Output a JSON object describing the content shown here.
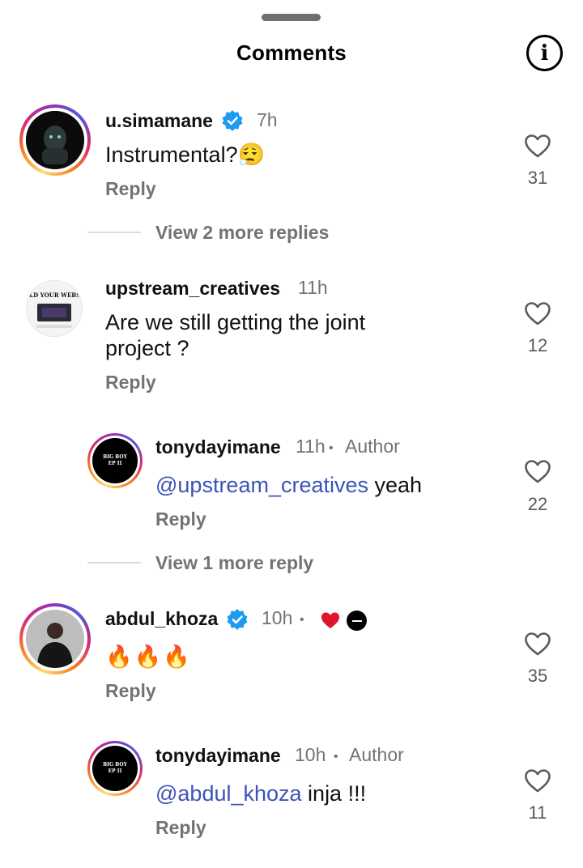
{
  "header": {
    "title": "Comments"
  },
  "colors": {
    "mention": "#3c53b8",
    "verified": "#1d9bf0",
    "heart_red": "#e0142a",
    "secondary_text": "#737373"
  },
  "comments": [
    {
      "username": "u.simamane",
      "verified": true,
      "time": "7h",
      "text": "Instrumental?😮‍💨",
      "reply_label": "Reply",
      "likes": "31",
      "view_more": "View 2 more replies"
    },
    {
      "username": "upstream_creatives",
      "verified": false,
      "time": "11h",
      "text_line1": "Are we still getting the joint",
      "text_line2": "project ?",
      "avatar_text": "BUILD YOUR WEBSITE",
      "reply_label": "Reply",
      "likes": "12",
      "replies": [
        {
          "username": "tonydayimane",
          "time": "11h",
          "separator": "•",
          "badge": "Author",
          "mention": "@upstream_creatives",
          "text": " yeah",
          "avatar_text": "BIG BOY EP II",
          "reply_label": "Reply",
          "likes": "22"
        }
      ],
      "view_more": "View 1 more reply"
    },
    {
      "username": "abdul_khoza",
      "verified": true,
      "time": "10h",
      "separator": "•",
      "text": "🔥🔥🔥",
      "reply_label": "Reply",
      "likes": "35",
      "replies": [
        {
          "username": "tonydayimane",
          "time": "10h",
          "separator": "•",
          "badge": "Author",
          "mention": "@abdul_khoza",
          "text": " inja !!!",
          "avatar_text": "BIG BOY EP II",
          "reply_label": "Reply",
          "likes": "11"
        }
      ]
    }
  ]
}
